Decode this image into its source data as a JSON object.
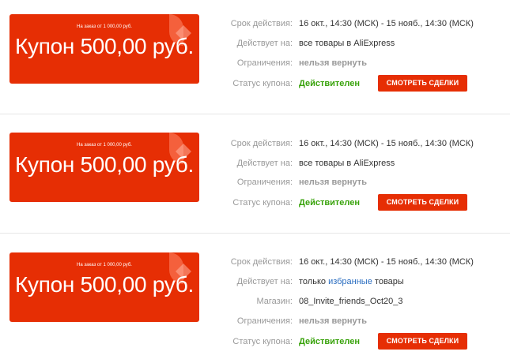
{
  "colors": {
    "accent": "#e62e04",
    "valid": "#39a30c",
    "link": "#2a6dc0",
    "label": "#999999"
  },
  "labels": {
    "validity": "Срок действия:",
    "applies": "Действует на:",
    "store": "Магазин:",
    "restrictions": "Ограничения:",
    "status": "Статус купона:",
    "deals_button": "СМОТРЕТЬ СДЕЛКИ"
  },
  "coupons": [
    {
      "min_order": "На заказ от 1 000,00 руб.",
      "amount": "Купон 500,00 руб.",
      "validity": "16 окт., 14:30 (МСК) - 15 нояб., 14:30 (МСК)",
      "applies": "все товары в AliExpress",
      "restrictions": "нельзя вернуть",
      "status": "Действителен"
    },
    {
      "min_order": "На заказ от 1 000,00 руб.",
      "amount": "Купон 500,00 руб.",
      "validity": "16 окт., 14:30 (МСК) - 15 нояб., 14:30 (МСК)",
      "applies": "все товары в AliExpress",
      "restrictions": "нельзя вернуть",
      "status": "Действителен"
    },
    {
      "min_order": "На заказ от 1 000,00 руб.",
      "amount": "Купон 500,00 руб.",
      "validity": "16 окт., 14:30 (МСК) - 15 нояб., 14:30 (МСК)",
      "applies_prefix": "только",
      "applies_link": "избранные",
      "applies_suffix": "товары",
      "store": "08_Invite_friends_Oct20_3",
      "restrictions": "нельзя вернуть",
      "status": "Действителен"
    }
  ]
}
